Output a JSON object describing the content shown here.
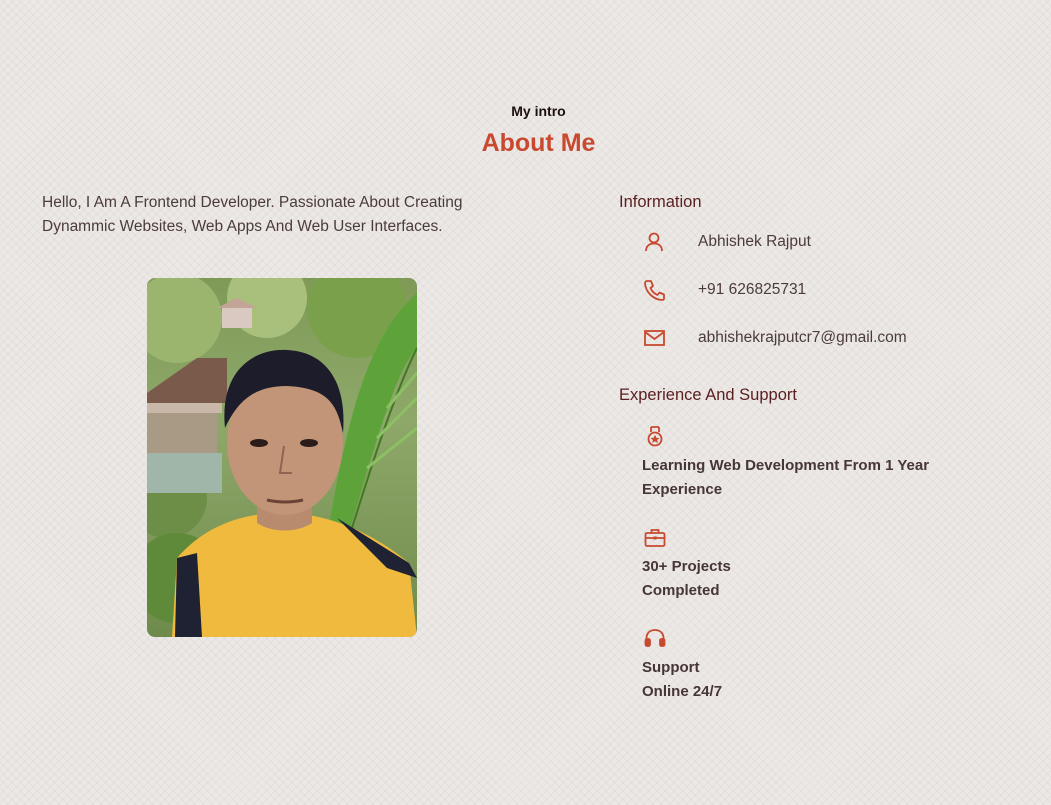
{
  "header": {
    "subtitle": "My intro",
    "title": "About Me"
  },
  "about": {
    "description": "Hello, I Am A Frontend Developer. Passionate About Creating Dynammic Websites, Web Apps And Web User Interfaces."
  },
  "information": {
    "heading": "Information",
    "items": [
      {
        "icon": "user-icon",
        "text": "Abhishek Rajput"
      },
      {
        "icon": "phone-icon",
        "text": "+91 626825731"
      },
      {
        "icon": "mail-icon",
        "text": "abhishekrajputcr7@gmail.com"
      }
    ]
  },
  "experience": {
    "heading": "Experience And Support",
    "items": [
      {
        "icon": "medal-icon",
        "text": "Learning Web Development From 1 Year\nExperience"
      },
      {
        "icon": "briefcase-icon",
        "text": "30+ Projects\nCompleted"
      },
      {
        "icon": "headset-icon",
        "text": "Support\nOnline 24/7"
      }
    ]
  },
  "colors": {
    "accent": "#c8492f",
    "heading": "#5a1e1e",
    "text": "#4b3b3b",
    "background": "#ece8e6"
  }
}
